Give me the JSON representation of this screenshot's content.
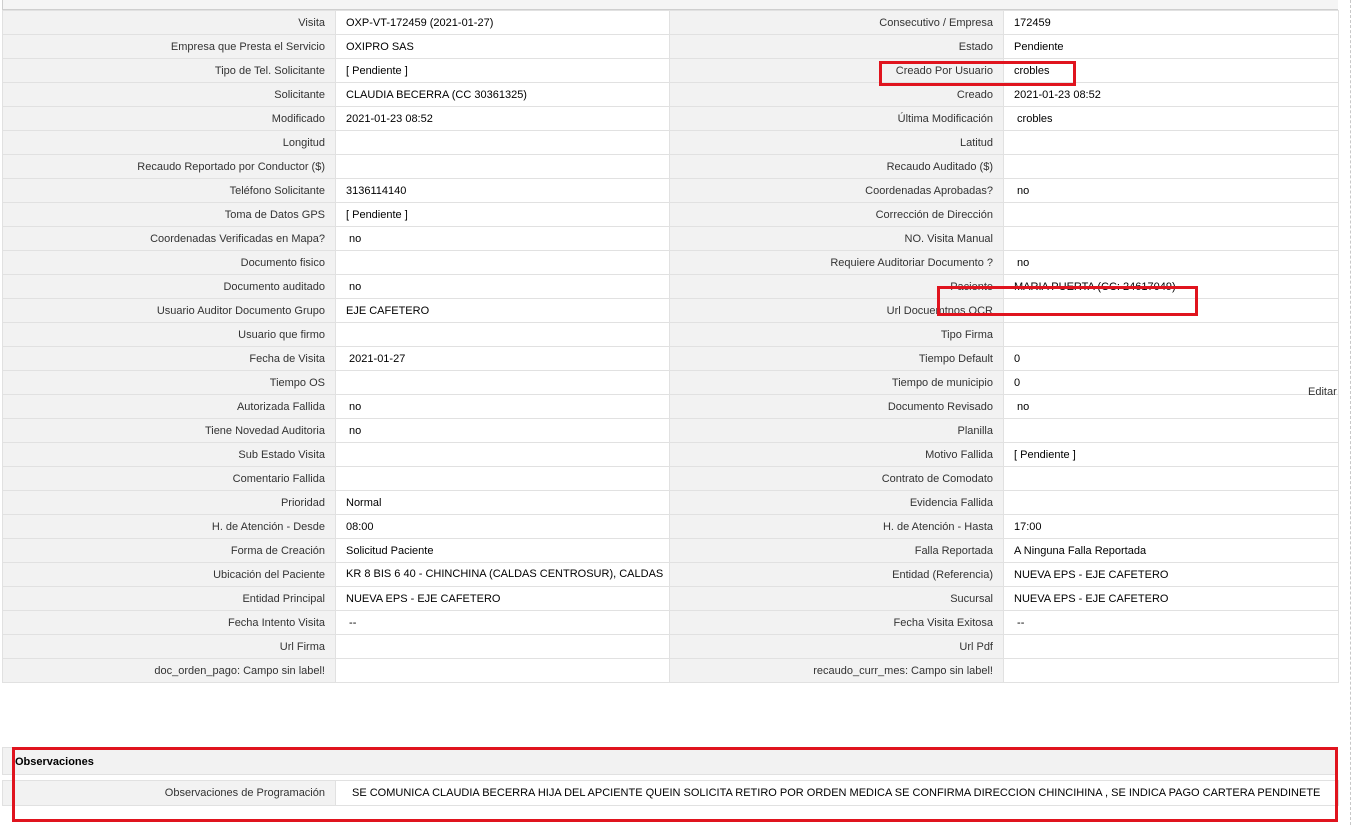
{
  "fields": [
    [
      "Visita",
      "OXP-VT-172459 (2021-01-27)",
      "Consecutivo / Empresa",
      "172459"
    ],
    [
      "Empresa que Presta el Servicio",
      "OXIPRO SAS",
      "Estado",
      "Pendiente"
    ],
    [
      "Tipo de Tel. Solicitante",
      "[ Pendiente ]",
      "Creado Por Usuario",
      "crobles"
    ],
    [
      "Solicitante",
      "CLAUDIA BECERRA (CC 30361325)",
      "Creado",
      "2021-01-23 08:52"
    ],
    [
      "Modificado",
      "2021-01-23 08:52",
      "Última Modificación",
      " crobles"
    ],
    [
      "Longitud",
      "",
      "Latitud",
      ""
    ],
    [
      "Recaudo Reportado por Conductor ($)",
      "",
      "Recaudo Auditado ($)",
      ""
    ],
    [
      "Teléfono Solicitante",
      "3136114140",
      "Coordenadas Aprobadas?",
      " no"
    ],
    [
      "Toma de Datos GPS",
      "[ Pendiente ]",
      "Corrección de Dirección",
      ""
    ],
    [
      "Coordenadas Verificadas en Mapa?",
      " no",
      "NO. Visita Manual",
      ""
    ],
    [
      "Documento fisico",
      "",
      "Requiere Auditoriar Documento ?",
      " no"
    ],
    [
      "Documento auditado",
      " no",
      "Paciente",
      "MARIA PUERTA (CC: 24617049)"
    ],
    [
      "Usuario Auditor Documento Grupo",
      "EJE CAFETERO",
      "Url Docuemtnos OCR",
      ""
    ],
    [
      "Usuario que firmo",
      "",
      "Tipo Firma",
      ""
    ],
    [
      "Fecha de Visita",
      " 2021-01-27",
      "Tiempo Default",
      "0"
    ],
    [
      "Tiempo OS",
      "",
      "Tiempo de municipio",
      "0"
    ],
    [
      "Autorizada Fallida",
      " no",
      "Documento Revisado",
      " no"
    ],
    [
      "Tiene Novedad Auditoria",
      " no",
      "Planilla",
      ""
    ],
    [
      "Sub Estado Visita",
      "",
      "Motivo Fallida",
      "[ Pendiente ]"
    ],
    [
      "Comentario Fallida",
      "",
      "Contrato de Comodato",
      ""
    ],
    [
      "Prioridad",
      "Normal",
      "Evidencia Fallida",
      ""
    ],
    [
      "H. de Atención - Desde",
      "08:00",
      "H. de Atención - Hasta",
      "17:00"
    ],
    [
      "Forma de Creación",
      "Solicitud Paciente",
      "Falla Reportada",
      "A Ninguna Falla Reportada"
    ],
    [
      "Ubicación del Paciente",
      "KR 8 BIS 6 40 - CHINCHINA (CALDAS CENTROSUR), CALDAS",
      "Entidad (Referencia)",
      "NUEVA EPS - EJE CAFETERO"
    ],
    [
      "Entidad Principal",
      "NUEVA EPS - EJE CAFETERO",
      "Sucursal",
      "NUEVA EPS - EJE CAFETERO"
    ],
    [
      "Fecha Intento Visita",
      " --",
      "Fecha Visita Exitosa",
      " --"
    ],
    [
      "Url Firma",
      "",
      "Url Pdf",
      ""
    ],
    [
      "doc_orden_pago: Campo sin label!",
      "",
      "recaudo_curr_mes: Campo sin label!",
      ""
    ]
  ],
  "editar_label": "Editar",
  "observaciones": {
    "title": "Observaciones",
    "label": "Observaciones de Programación",
    "value": "SE COMUNICA CLAUDIA BECERRA HIJA DEL APCIENTE QUEIN SOLICITA RETIRO POR ORDEN MEDICA SE CONFIRMA DIRECCION CHINCIHINA , SE INDICA PAGO CARTERA PENDINETE"
  },
  "colors": {
    "highlight": "#e0141e",
    "label_bg": "#f2f2f2",
    "border": "#e1e1e1"
  }
}
